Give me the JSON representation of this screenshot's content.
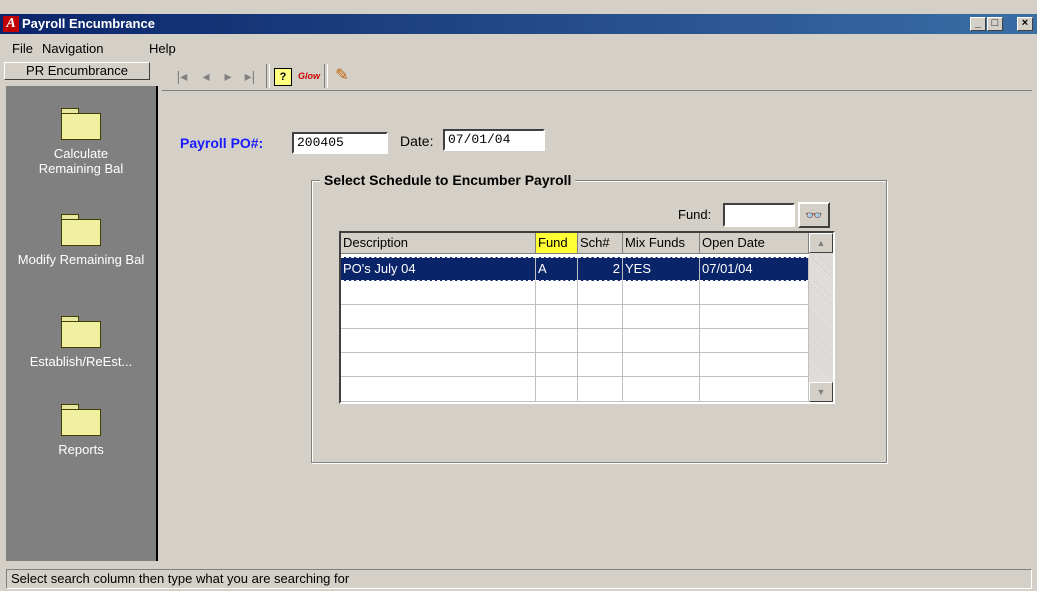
{
  "window": {
    "title": "Payroll Encumbrance",
    "app_icon_letter": "A"
  },
  "menu": [
    {
      "label": "File"
    },
    {
      "label": "Navigation"
    },
    {
      "label": "Help"
    }
  ],
  "sidebar": {
    "tab_label": "PR Encumbrance",
    "items": [
      {
        "label": "Calculate Remaining Bal",
        "icon": "folder-icon"
      },
      {
        "label": "Modify Remaining Bal",
        "icon": "folder-icon"
      },
      {
        "label": "Establish/ReEst...",
        "icon": "folder-icon"
      },
      {
        "label": "Reports",
        "icon": "folder-icon"
      }
    ]
  },
  "toolbar": {
    "buttons": [
      "first-record-icon",
      "prev-record-icon",
      "next-record-icon",
      "last-record-icon",
      "help-icon",
      "glow-icon",
      "exit-icon"
    ]
  },
  "form": {
    "po_label": "Payroll PO#:",
    "po_value": "200405",
    "date_label": "Date:",
    "date_value": "07/01/04"
  },
  "schedule_group": {
    "title": "Select Schedule to Encumber Payroll",
    "fund_label": "Fund:",
    "fund_value": "",
    "columns": [
      "Description",
      "Fund",
      "Sch#",
      "Mix Funds",
      "Open Date"
    ],
    "highlight_column": "Fund",
    "rows": [
      {
        "description": "PO's July 04",
        "fund": "A",
        "sch": "2",
        "mix_funds": "YES",
        "open_date": "07/01/04"
      }
    ]
  },
  "status_bar": {
    "text": "Select search column then type what you are searching for"
  },
  "colors": {
    "title_bar": "#0a246a",
    "sidebar_bg": "#808080",
    "label_blue": "#1a1aff",
    "selection": "#0a246a",
    "column_highlight": "#ffff33"
  }
}
